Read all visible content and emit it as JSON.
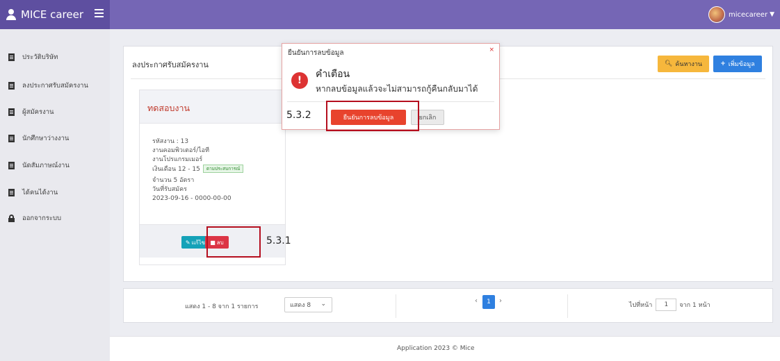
{
  "app": {
    "title": "MICE career",
    "username": "micecareer"
  },
  "sidebar": {
    "items": [
      {
        "label": "ประวัติบริษัท",
        "icon": "document-icon"
      },
      {
        "label": "ลงประกาศรับสมัครงาน",
        "icon": "document-icon"
      },
      {
        "label": "ผู้สมัครงาน",
        "icon": "document-icon"
      },
      {
        "label": "นักศึกษาว่างงาน",
        "icon": "document-icon"
      },
      {
        "label": "นัดสัมภาษณ์งาน",
        "icon": "document-icon"
      },
      {
        "label": "ได้คนได้งาน",
        "icon": "document-icon"
      },
      {
        "label": "ออกจากระบบ",
        "icon": "lock-icon"
      }
    ]
  },
  "main": {
    "title": "ลงประกาศรับสมัครงาน",
    "search_label": "ค้นหางาน",
    "add_label": "เพิ่มข้อมูล"
  },
  "job": {
    "title": "ทดสอบงาน",
    "code": "รหัสงาน : 13",
    "category": "งานคอมพิวเตอร์/ไอที",
    "position": "งานโปรแกรมเมอร์",
    "salary": "เงินเดือน 12 - 15",
    "salary_badge": "ตามประสบการณ์",
    "openings": "จำนวน 5 อัตรา",
    "date_label": "วันที่รับสมัคร",
    "date_range": "2023-09-16 - 0000-00-00",
    "edit_label": "แก้ไข",
    "delete_label": "ลบ"
  },
  "dialog": {
    "title": "ยืนยันการลบข้อมูล",
    "close": "×",
    "heading": "คำเตือน",
    "message": "หากลบข้อมูลแล้วจะไม่สามารถกู้คืนกลับมาได้",
    "confirm_label": "ยืนยันการลบข้อมูล",
    "cancel_label": "ยกเลิก"
  },
  "annotations": {
    "step1": "5.3.1",
    "step2": "5.3.2"
  },
  "pagination": {
    "info": "แสดง 1 - 8 จาก 1 รายการ",
    "page_size": "แสดง 8",
    "current_page": "1",
    "goto_label": "ไปที่หน้า",
    "goto_value": "1",
    "total_label": "จาก 1 หน้า"
  },
  "footer": {
    "text": "Application 2023 © Mice"
  }
}
